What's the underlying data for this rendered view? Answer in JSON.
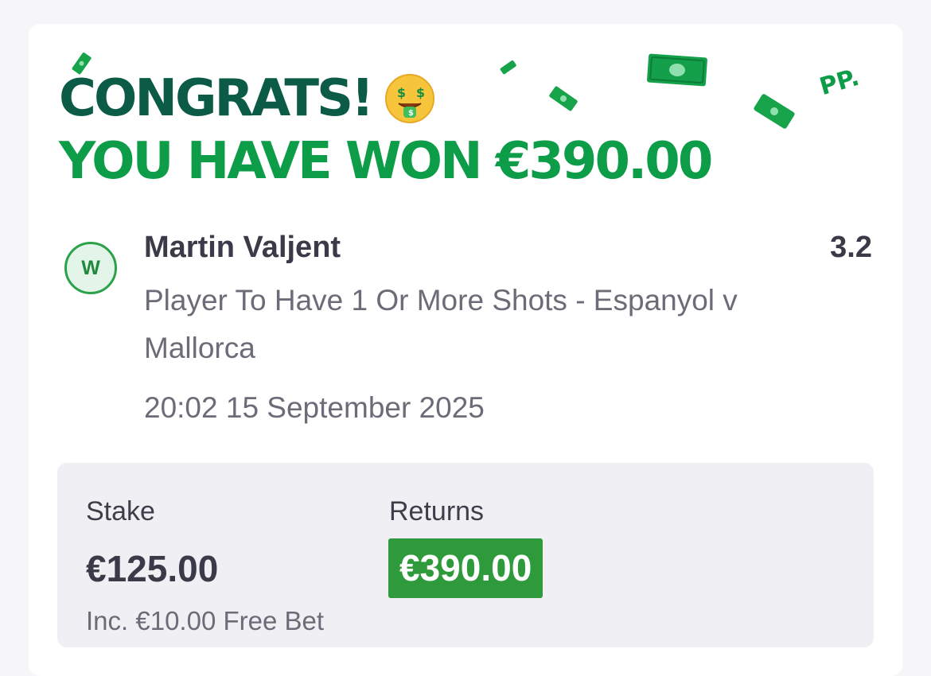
{
  "banner": {
    "line1": "CONGRATS!",
    "line2": "YOU HAVE WON €390.00",
    "emoji_icon": "money-mouth-face-icon",
    "brand_mark": "PP.",
    "colors": {
      "dark_green": "#0b5b47",
      "bright_green": "#0d9c47"
    }
  },
  "bet": {
    "result_badge": "W",
    "selection": "Martin Valjent",
    "odds": "3.2",
    "market": "Player To Have 1 Or More Shots - Espanyol v Mallorca",
    "datetime": "20:02 15 September 2025"
  },
  "summary": {
    "stake_label": "Stake",
    "stake_value": "€125.00",
    "returns_label": "Returns",
    "returns_value": "€390.00",
    "free_bet_note": "Inc. €10.00 Free Bet",
    "returns_bg": "#2f9a3c"
  }
}
